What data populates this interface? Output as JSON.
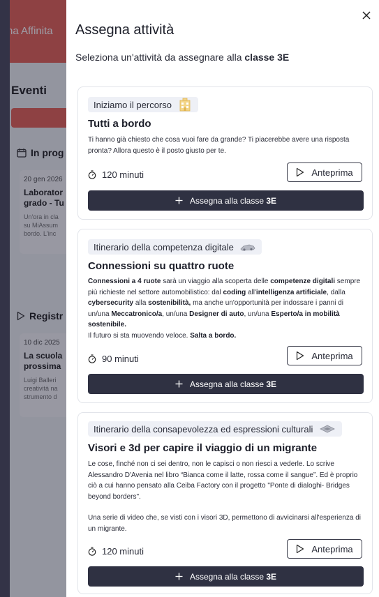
{
  "background": {
    "brand": "na Affinita",
    "section_events": "Eventi",
    "sub_in_progress": "In prog",
    "card1": {
      "date": "20 gen 2026",
      "title1": "Laborator",
      "title2": "grado - Tu",
      "text1": "Un'ora in cla",
      "text2": "su MiAssum",
      "text3": "bordo. L'inc"
    },
    "sub_registered": "Registr",
    "card2": {
      "date": "10 dic 2025",
      "title1": "La scuola",
      "title2": "prossima",
      "text1": "Luigi Balleri",
      "text2": "creatività na",
      "text3": "strumento d"
    }
  },
  "modal": {
    "title": "Assegna attività",
    "subtitle_prefix": "Seleziona un'attività da assegnare alla ",
    "subtitle_class": "classe 3E"
  },
  "activities": [
    {
      "tag": "Iniziamo il percorso",
      "tag_icon": "building-icon",
      "title": "Tutti a bordo",
      "description": "Ti hanno già chiesto che cosa vuoi fare da grande? Ti piacerebbe avere una risposta pronta? Allora questo è il posto giusto per te.",
      "duration": "120 minuti",
      "preview_label": "Anteprima",
      "assign_prefix": "Assegna alla classe ",
      "assign_class": "3E"
    },
    {
      "tag": "Itinerario della competenza digitale",
      "tag_icon": "car-icon",
      "title": "Connessioni su quattro ruote",
      "description_parts": [
        {
          "b": "Connessioni a 4 ruote"
        },
        {
          "t": " sarà un viaggio alla scoperta delle "
        },
        {
          "b": "competenze digitali"
        },
        {
          "t": " sempre più richieste nel settore automobilistico: dal "
        },
        {
          "b": "coding"
        },
        {
          "t": " all'"
        },
        {
          "b": "intelligenza artificiale"
        },
        {
          "t": ", dalla "
        },
        {
          "b": "cybersecurity"
        },
        {
          "t": " alla "
        },
        {
          "b": "sostenibilità,"
        },
        {
          "t": " ma anche un'opportunità per indossare i panni di un/una "
        },
        {
          "b": "Meccatronico/a"
        },
        {
          "t": ", un/una "
        },
        {
          "b": "Designer di auto"
        },
        {
          "t": ", un/una "
        },
        {
          "b": "Esperto/a in mobilità sostenibile."
        },
        {
          "br": true
        },
        {
          "t": "Il futuro si sta muovendo veloce. "
        },
        {
          "b": "Salta a bordo."
        }
      ],
      "duration": "90 minuti",
      "preview_label": "Anteprima",
      "assign_prefix": "Assegna alla classe ",
      "assign_class": "3E"
    },
    {
      "tag": "Itinerario della consapevolezza ed espressioni culturali",
      "tag_icon": "headset-icon",
      "title": "Visori e 3d per capire il viaggio di un migrante",
      "description_p1": "Le cose, finché non ci sei dentro, non le capisci o non riesci a vederle. Lo scrive Alessandro D'Avenia nel libro “Bianca come il latte, rossa come il sangue”. Ed è proprio ciò a cui hanno pensato alla Ceiba Factory con il progetto \"Ponte di dialoghi- Bridges beyond borders\".",
      "description_p2": "Una serie di video che, se visti con i visori 3D, permettono di avvicinarsi all'esperienza di un migrante.",
      "duration": "120 minuti",
      "preview_label": "Anteprima",
      "assign_prefix": "Assegna alla classe ",
      "assign_class": "3E"
    }
  ]
}
